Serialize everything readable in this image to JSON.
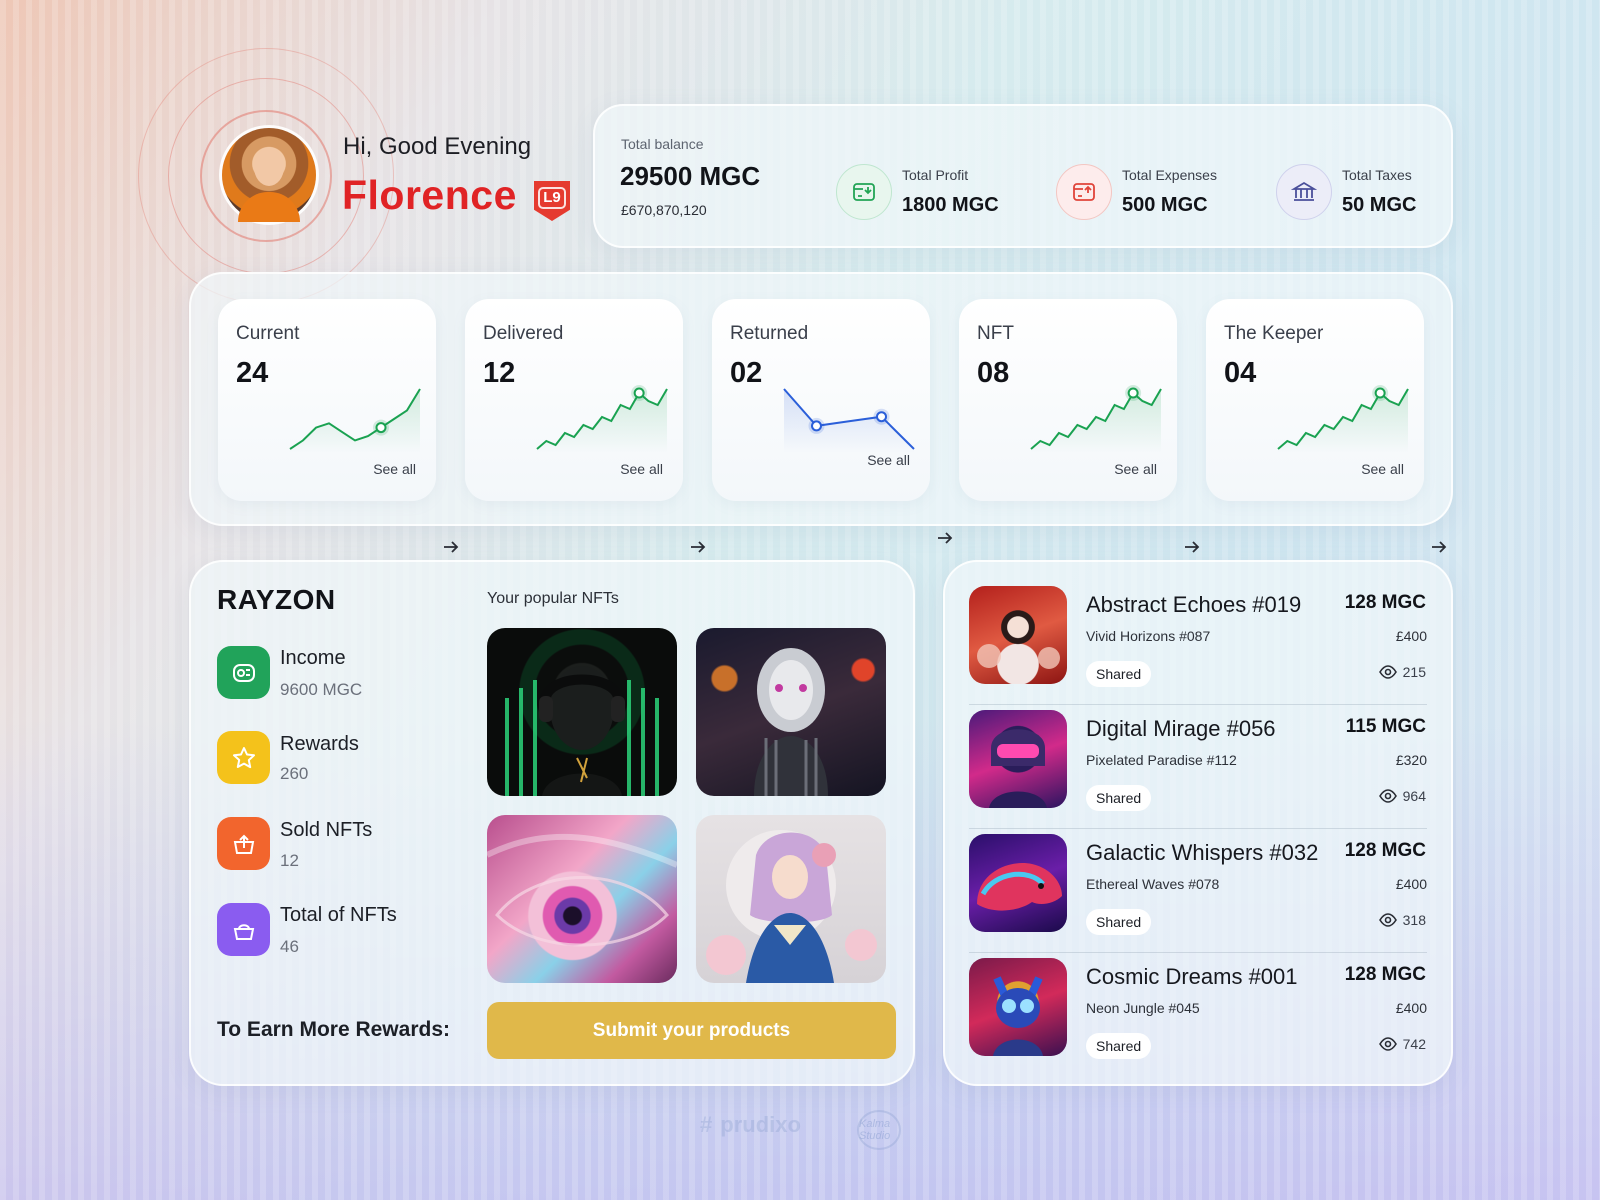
{
  "profile": {
    "greeting": "Hi, Good Evening",
    "name": "Florence",
    "level": "L9"
  },
  "balance": {
    "label": "Total balance",
    "value": "29500 MGC",
    "fiat": "£670,870,120",
    "stats": [
      {
        "label": "Total Profit",
        "value": "1800 MGC",
        "icon": "wallet-in-icon",
        "color": "#22a455"
      },
      {
        "label": "Total Expenses",
        "value": "500 MGC",
        "icon": "wallet-out-icon",
        "color": "#e0443a"
      },
      {
        "label": "Total Taxes",
        "value": "50 MGC",
        "icon": "bank-icon",
        "color": "#4a4f9a"
      }
    ]
  },
  "kpis": [
    {
      "label": "Current",
      "value": "24",
      "see_all": "See all",
      "trend": "up",
      "color": "#1aa251",
      "chart_data": {
        "type": "line",
        "values": [
          2,
          4,
          7,
          8,
          6,
          4,
          5,
          7,
          9,
          11,
          16
        ]
      }
    },
    {
      "label": "Delivered",
      "value": "12",
      "see_all": "See all",
      "trend": "up",
      "color": "#1aa251",
      "chart_data": {
        "type": "line",
        "values": [
          1,
          3,
          2,
          5,
          4,
          7,
          6,
          9,
          8,
          12,
          11,
          15,
          13,
          12,
          16
        ]
      }
    },
    {
      "label": "Returned",
      "value": "02",
      "see_all": "See all",
      "trend": "down",
      "color": "#2b5fd9",
      "chart_data": {
        "type": "line",
        "values": [
          14,
          6,
          7,
          8,
          1
        ]
      }
    },
    {
      "label": "NFT",
      "value": "08",
      "see_all": "See all",
      "trend": "up",
      "color": "#1aa251",
      "chart_data": {
        "type": "line",
        "values": [
          1,
          3,
          2,
          5,
          4,
          7,
          6,
          9,
          8,
          12,
          11,
          15,
          13,
          12,
          16
        ]
      }
    },
    {
      "label": "The Keeper",
      "value": "04",
      "see_all": "See all",
      "trend": "up",
      "color": "#1aa251",
      "chart_data": {
        "type": "line",
        "values": [
          1,
          3,
          2,
          5,
          4,
          7,
          6,
          9,
          8,
          12,
          11,
          15,
          13,
          12,
          16
        ]
      }
    }
  ],
  "rayzon": {
    "brand": "RAYZON",
    "popular_label": "Your popular NFTs",
    "metrics": [
      {
        "label": "Income",
        "value": "9600 MGC",
        "icon": "coins-icon",
        "color": "#21a35a"
      },
      {
        "label": "Rewards",
        "value": "260",
        "icon": "star-icon",
        "color": "#f4c21b"
      },
      {
        "label": "Sold NFTs",
        "value": "12",
        "icon": "bag-upload-icon",
        "color": "#f2652d"
      },
      {
        "label": "Total of NFTs",
        "value": "46",
        "icon": "basket-icon",
        "color": "#8a5cf0"
      }
    ],
    "earn_label": "To Earn More Rewards:",
    "submit_label": "Submit your products"
  },
  "nft_list": [
    {
      "title": "Abstract Echoes #019",
      "price": "128 MGC",
      "collection": "Vivid Horizons #087",
      "fiat": "£400",
      "tag": "Shared",
      "views": "215"
    },
    {
      "title": "Digital Mirage #056",
      "price": "115 MGC",
      "collection": "Pixelated Paradise #112",
      "fiat": "£320",
      "tag": "Shared",
      "views": "964"
    },
    {
      "title": "Galactic Whispers #032",
      "price": "128 MGC",
      "collection": "Ethereal Waves #078",
      "fiat": "£400",
      "tag": "Shared",
      "views": "318"
    },
    {
      "title": "Cosmic Dreams #001",
      "price": "128 MGC",
      "collection": "Neon Jungle #045",
      "fiat": "£400",
      "tag": "Shared",
      "views": "742"
    }
  ],
  "watermark": {
    "brand": "prudixo",
    "studio": "Kalma Studio"
  }
}
